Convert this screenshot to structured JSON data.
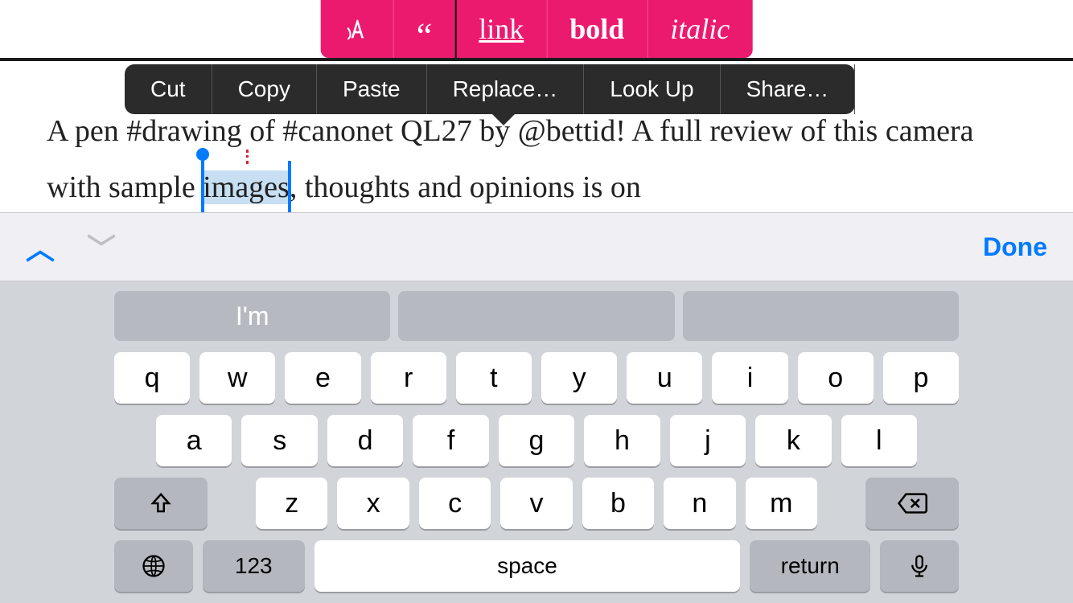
{
  "format_toolbar": {
    "style_icon": "style-icon",
    "quote_icon": "quote-icon",
    "link": "link",
    "bold": "bold",
    "italic": "italic"
  },
  "context_menu": {
    "cut": "Cut",
    "copy": "Copy",
    "paste": "Paste",
    "replace": "Replace…",
    "lookup": "Look Up",
    "share": "Share…"
  },
  "editor": {
    "pre_text": "A pen #drawing of #canonet QL27 by @bettid! A full review of this camera with sample ",
    "selected": "images",
    "post_text": ", thoughts and opinions is on"
  },
  "accessory": {
    "done": "Done"
  },
  "keyboard": {
    "suggestions": [
      "I'm",
      "",
      ""
    ],
    "row1": [
      "q",
      "w",
      "e",
      "r",
      "t",
      "y",
      "u",
      "i",
      "o",
      "p"
    ],
    "row2": [
      "a",
      "s",
      "d",
      "f",
      "g",
      "h",
      "j",
      "k",
      "l"
    ],
    "row3": [
      "z",
      "x",
      "c",
      "v",
      "b",
      "n",
      "m"
    ],
    "num": "123",
    "space": "space",
    "return": "return"
  }
}
